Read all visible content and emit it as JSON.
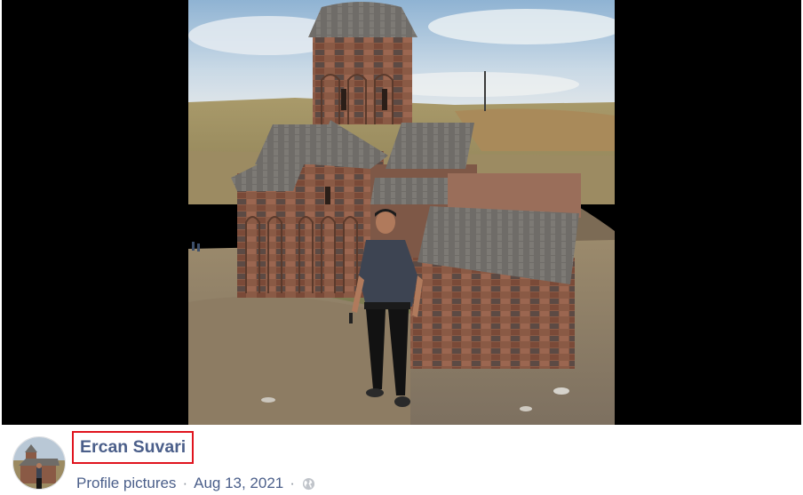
{
  "post": {
    "author_name": "Ercan Suvari",
    "album_label": "Profile pictures",
    "separator": "·",
    "date": "Aug 13, 2021",
    "privacy_icon": "globe-icon"
  },
  "colors": {
    "name_link": "#4b5f8a",
    "meta_text": "#616770",
    "highlight_box": "#e0141e",
    "viewer_background": "#000000"
  }
}
